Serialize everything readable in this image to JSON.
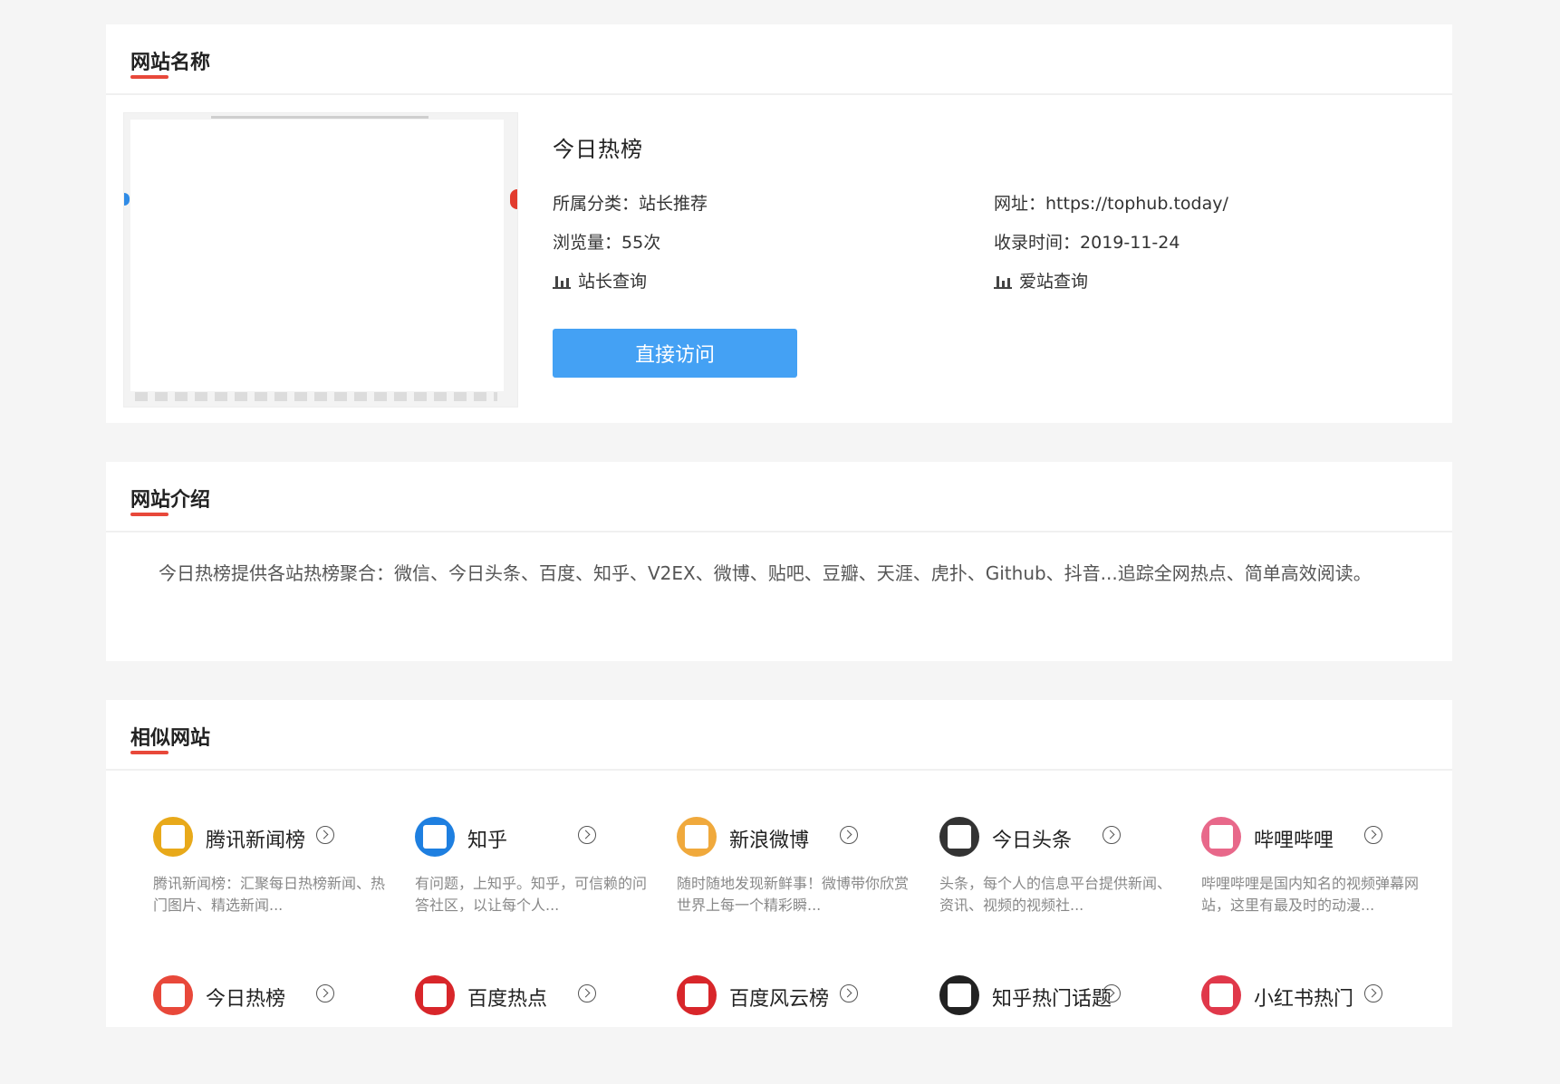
{
  "info": {
    "title": "网站名称",
    "site_name": "今日热榜",
    "category_label": "所属分类：",
    "category_value": "站长推荐",
    "url_label": "网址：",
    "url_value": "https://tophub.today/",
    "views_label": "浏览量：",
    "views_value": "55次",
    "date_label": "收录时间：",
    "date_value": "2019-11-24",
    "link1": "站长查询",
    "link2": "爱站查询",
    "visit_button": "直接访问"
  },
  "intro": {
    "title": "网站介绍",
    "text": "今日热榜提供各站热榜聚合：微信、今日头条、百度、知乎、V2EX、微博、贴吧、豆瓣、天涯、虎扑、Github、抖音...追踪全网热点、简单高效阅读。"
  },
  "similar": {
    "title": "相似网站",
    "items": [
      {
        "name": "腾讯新闻榜",
        "desc": "腾讯新闻榜：汇聚每日热榜新闻、热门图片、精选新闻...",
        "color": "#e8a91a"
      },
      {
        "name": "知乎",
        "desc": "有问题，上知乎。知乎，可信赖的问答社区，以让每个人...",
        "color": "#1e7fe0"
      },
      {
        "name": "新浪微博",
        "desc": "随时随地发现新鲜事！微博带你欣赏世界上每一个精彩瞬...",
        "color": "#f0a93c"
      },
      {
        "name": "今日头条",
        "desc": "头条，每个人的信息平台提供新闻、资讯、视频的视频社...",
        "color": "#333333"
      },
      {
        "name": "哔哩哔哩",
        "desc": "哔哩哔哩是国内知名的视频弹幕网站，这里有最及时的动漫...",
        "color": "#e8688a"
      },
      {
        "name": "今日热榜",
        "desc": "",
        "color": "#e8483a"
      },
      {
        "name": "百度热点",
        "desc": "",
        "color": "#d8262a"
      },
      {
        "name": "百度风云榜",
        "desc": "",
        "color": "#d8262a"
      },
      {
        "name": "知乎热门话题",
        "desc": "",
        "color": "#222222"
      },
      {
        "name": "小红书热门",
        "desc": "",
        "color": "#e0384a"
      }
    ]
  }
}
